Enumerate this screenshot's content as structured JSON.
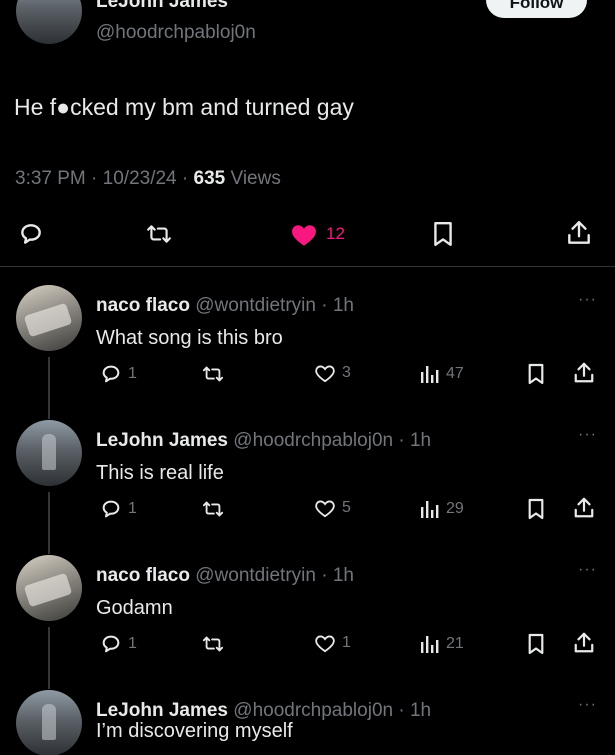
{
  "main_tweet": {
    "author_name": "LeJohn James",
    "author_handle": "@hoodrchpabloj0n",
    "follow_label": "Follow",
    "text": "He f●cked my bm and turned gay",
    "time": "3:37 PM",
    "date": "10/23/24",
    "views_count": "635",
    "views_label": "Views",
    "like_count": "12",
    "accent_color": "#f91880"
  },
  "replies": [
    {
      "name": "naco flaco",
      "handle": "@wontdietryin",
      "time": "1h",
      "text": "What song is this bro",
      "replies": "1",
      "likes": "3",
      "views": "47",
      "more": "···"
    },
    {
      "name": "LeJohn James",
      "handle": "@hoodrchpabloj0n",
      "time": "1h",
      "text": "This is real life",
      "replies": "1",
      "likes": "5",
      "views": "29",
      "more": "···"
    },
    {
      "name": "naco flaco",
      "handle": "@wontdietryin",
      "time": "1h",
      "text": "Godamn",
      "replies": "1",
      "likes": "1",
      "views": "21",
      "more": "···"
    },
    {
      "name": "LeJohn James",
      "handle": "@hoodrchpabloj0n",
      "time": "1h",
      "text": "I’m discovering myself",
      "more": "···"
    }
  ],
  "icons": {
    "reply": "reply-icon",
    "retweet": "retweet-icon",
    "like": "heart-icon",
    "views": "views-icon",
    "bookmark": "bookmark-icon",
    "share": "share-icon"
  }
}
